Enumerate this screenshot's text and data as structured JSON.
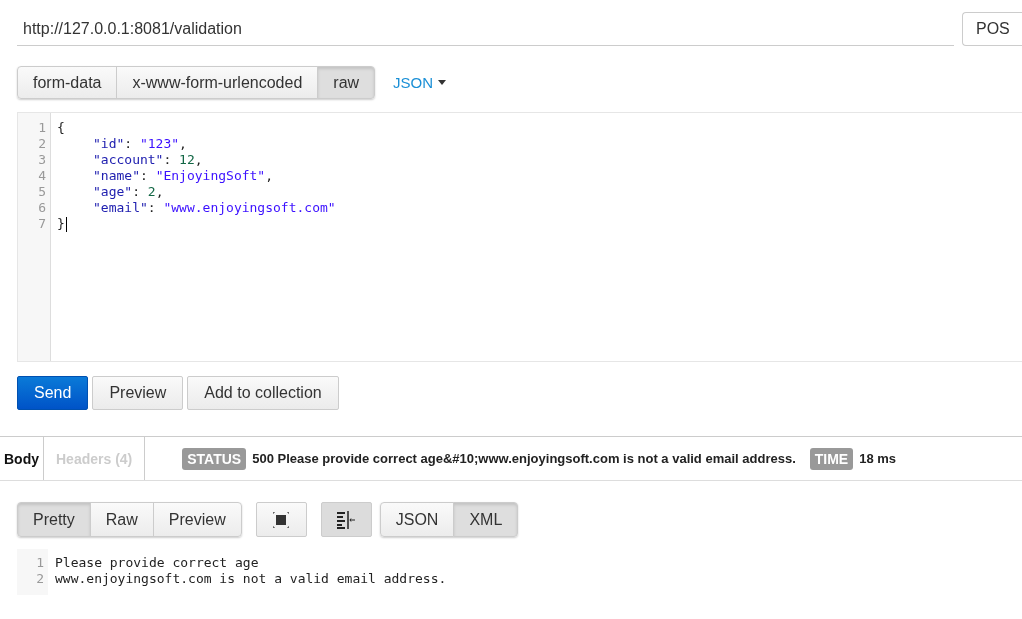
{
  "request": {
    "url": "http://127.0.0.1:8081/validation",
    "method": "POS"
  },
  "body_modes": [
    {
      "label": "form-data",
      "selected": false
    },
    {
      "label": "x-www-form-urlencoded",
      "selected": false
    },
    {
      "label": "raw",
      "selected": true
    }
  ],
  "language": "JSON",
  "editor": {
    "lines": [
      {
        "number": "1",
        "indent": false,
        "cursor": false,
        "tokens": [
          {
            "kind": "punct",
            "text": "{"
          }
        ]
      },
      {
        "number": "2",
        "indent": true,
        "cursor": false,
        "tokens": [
          {
            "kind": "key",
            "text": "\"id\""
          },
          {
            "kind": "punct",
            "text": ": "
          },
          {
            "kind": "string",
            "text": "\"123\""
          },
          {
            "kind": "punct",
            "text": ","
          }
        ]
      },
      {
        "number": "3",
        "indent": true,
        "cursor": false,
        "tokens": [
          {
            "kind": "key",
            "text": "\"account\""
          },
          {
            "kind": "punct",
            "text": ": "
          },
          {
            "kind": "number",
            "text": "12"
          },
          {
            "kind": "punct",
            "text": ","
          }
        ]
      },
      {
        "number": "4",
        "indent": true,
        "cursor": false,
        "tokens": [
          {
            "kind": "key",
            "text": "\"name\""
          },
          {
            "kind": "punct",
            "text": ": "
          },
          {
            "kind": "string",
            "text": "\"EnjoyingSoft\""
          },
          {
            "kind": "punct",
            "text": ","
          }
        ]
      },
      {
        "number": "5",
        "indent": true,
        "cursor": false,
        "tokens": [
          {
            "kind": "key",
            "text": "\"age\""
          },
          {
            "kind": "punct",
            "text": ": "
          },
          {
            "kind": "number",
            "text": "2"
          },
          {
            "kind": "punct",
            "text": ","
          }
        ]
      },
      {
        "number": "6",
        "indent": true,
        "cursor": false,
        "tokens": [
          {
            "kind": "key",
            "text": "\"email\""
          },
          {
            "kind": "punct",
            "text": ": "
          },
          {
            "kind": "string",
            "text": "\"www.enjoyingsoft.com\""
          }
        ]
      },
      {
        "number": "7",
        "indent": false,
        "cursor": true,
        "tokens": [
          {
            "kind": "punct",
            "text": "}"
          }
        ]
      }
    ]
  },
  "actions": [
    {
      "label": "Send",
      "kind": "primary"
    },
    {
      "label": "Preview",
      "kind": "default"
    },
    {
      "label": "Add to collection",
      "kind": "default"
    }
  ],
  "response": {
    "tabs": [
      {
        "label": "Body",
        "selected": true
      },
      {
        "label": "Headers (4)",
        "selected": false
      }
    ],
    "status_label": "STATUS",
    "status": "500 Please provide correct age&#10;www.enjoyingsoft.com is not a valid email address.",
    "time_label": "TIME",
    "time": "18 ms",
    "view_modes": [
      {
        "label": "Pretty",
        "selected": true
      },
      {
        "label": "Raw",
        "selected": false
      },
      {
        "label": "Preview",
        "selected": false
      }
    ],
    "fullscreen_on": false,
    "wrap_on": true,
    "formats": [
      {
        "label": "JSON",
        "selected": false
      },
      {
        "label": "XML",
        "selected": true
      }
    ],
    "lines": [
      {
        "number": "1",
        "text": "Please provide correct age"
      },
      {
        "number": "2",
        "text": "www.enjoyingsoft.com is not a valid email address."
      }
    ]
  }
}
